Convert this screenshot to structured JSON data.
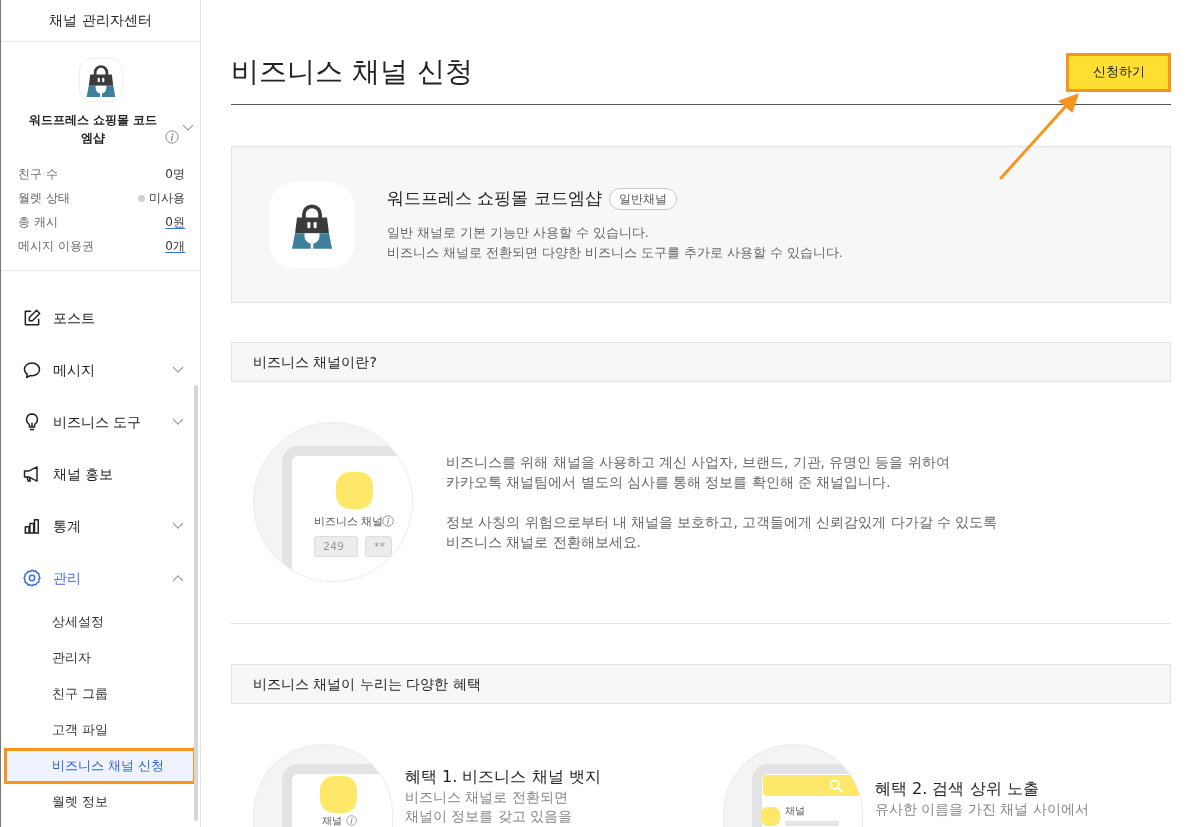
{
  "sidebar": {
    "title": "채널 관리자센터",
    "profile": {
      "name": "워드프레스 쇼핑몰 코드엠샵",
      "stats": [
        {
          "kind": "plain",
          "label": "친구 수",
          "value": "0명"
        },
        {
          "kind": "status",
          "label": "월렛 상태",
          "value": "미사용"
        },
        {
          "kind": "link",
          "label": "총 캐시",
          "value": "0원"
        },
        {
          "kind": "link",
          "label": "메시지 이용권",
          "value": "0개"
        }
      ]
    },
    "menu": [
      {
        "kind": "link",
        "label": "포스트",
        "active": false,
        "expanded": false
      },
      {
        "kind": "group",
        "label": "메시지",
        "active": false,
        "expanded": false
      },
      {
        "kind": "group",
        "label": "비즈니스 도구",
        "active": false,
        "expanded": false
      },
      {
        "kind": "link",
        "label": "채널 홍보",
        "active": false,
        "expanded": false
      },
      {
        "kind": "group",
        "label": "통계",
        "active": false,
        "expanded": false
      },
      {
        "kind": "group",
        "label": "관리",
        "active": true,
        "expanded": true,
        "children": [
          {
            "label": "상세설정",
            "selected": false,
            "outlined": false
          },
          {
            "label": "관리자",
            "selected": false,
            "outlined": false
          },
          {
            "label": "친구 그룹",
            "selected": false,
            "outlined": false
          },
          {
            "label": "고객 파일",
            "selected": false,
            "outlined": false
          },
          {
            "label": "비즈니스 채널 신청",
            "selected": true,
            "outlined": true
          },
          {
            "label": "월렛 정보",
            "selected": false,
            "outlined": false
          }
        ]
      }
    ]
  },
  "header": {
    "title": "비즈니스 채널 신청",
    "apply_button": {
      "label": "신청하기",
      "outlined": true,
      "pointer_arrow": true
    }
  },
  "channel_card": {
    "name": "워드프레스 쇼핑몰 코드엠샵",
    "badge": "일반채널",
    "description": [
      "일반 채널로 기본 기능만 사용할 수 있습니다.",
      "비즈니스 채널로 전환되면 다양한 비즈니스 도구를 추가로 사용할 수 있습니다."
    ]
  },
  "about": {
    "heading": "비즈니스 채널이란?",
    "illustration": {
      "label": "비즈니스 채널",
      "fields": [
        "249",
        "**"
      ]
    },
    "paragraphs": [
      [
        "비즈니스를 위해 채널을 사용하고 계신 사업자, 브랜드, 기관, 유명인 등을 위하여",
        "카카오톡 채널팀에서 별도의 심사를 통해 정보를 확인해 준 채널입니다."
      ],
      [
        "정보 사칭의 위험으로부터 내 채널을 보호하고, 고객들에게 신뢰감있게 다가갈 수 있도록",
        "비즈니스 채널로 전환해보세요."
      ]
    ]
  },
  "benefits": {
    "heading": "비즈니스 채널이 누리는 다양한 혜택",
    "items": [
      {
        "kind": "badge",
        "title": "혜택 1. 비즈니스 채널 뱃지",
        "lines": [
          "비즈니스 채널로 전환되면",
          "채널이 정보를 갖고 있음을"
        ],
        "illustration_label": "채널"
      },
      {
        "kind": "search",
        "title": "혜택 2. 검색 상위 노출",
        "lines": [
          "유사한 이름을 가진 채널 사이에서"
        ],
        "illustration_label": "채널"
      }
    ]
  }
}
